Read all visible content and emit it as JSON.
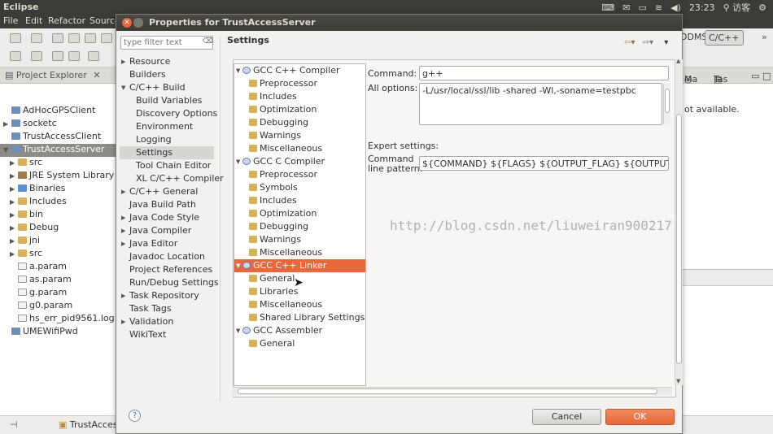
{
  "system": {
    "app_name": "Eclipse",
    "clock": "23:23",
    "user": "访客",
    "volume_icon": "volume-icon"
  },
  "menu": [
    "File",
    "Edit",
    "Refactor",
    "Source"
  ],
  "perspectives": {
    "ddms": "DDMS",
    "cc": "C/C++"
  },
  "project_explorer": {
    "tab_label": "Project Explorer",
    "items": [
      {
        "label": "AdHocGPSClient",
        "icon": "project-icon"
      },
      {
        "label": "socketc",
        "icon": "project-icon"
      },
      {
        "label": "TrustAccessClient",
        "icon": "project-icon"
      },
      {
        "label": "TrustAccessServer",
        "icon": "project-icon"
      },
      {
        "label": "src",
        "icon": "folder-icon"
      },
      {
        "label": "JRE System Library [Ja",
        "icon": "library-icon"
      },
      {
        "label": "Binaries",
        "icon": "binary-icon"
      },
      {
        "label": "Includes",
        "icon": "folder-icon"
      },
      {
        "label": "bin",
        "icon": "folder-icon"
      },
      {
        "label": "Debug",
        "icon": "folder-icon"
      },
      {
        "label": "jni",
        "icon": "folder-icon"
      },
      {
        "label": "src",
        "icon": "folder-icon"
      },
      {
        "label": "a.param",
        "icon": "file-icon"
      },
      {
        "label": "as.param",
        "icon": "file-icon"
      },
      {
        "label": "g.param",
        "icon": "file-icon"
      },
      {
        "label": "g0.param",
        "icon": "file-icon"
      },
      {
        "label": "hs_err_pid9561.log",
        "icon": "file-icon"
      },
      {
        "label": "UMEWifiPwd",
        "icon": "project-icon"
      }
    ]
  },
  "right_panel": {
    "tab_ma": "Ma",
    "tab_tas": "Tas",
    "message": "ot available."
  },
  "taskbar": {
    "item": "TrustAccessSe"
  },
  "dialog": {
    "title": "Properties for TrustAccessServer",
    "filter_placeholder": "type filter text",
    "page_title": "Settings",
    "nav": [
      {
        "label": "Resource",
        "expandable": true
      },
      {
        "label": "Builders",
        "expandable": false
      },
      {
        "label": "C/C++ Build",
        "expandable": true
      },
      {
        "label": "Build Variables",
        "expandable": false
      },
      {
        "label": "Discovery Options",
        "expandable": false
      },
      {
        "label": "Environment",
        "expandable": false
      },
      {
        "label": "Logging",
        "expandable": false
      },
      {
        "label": "Settings",
        "expandable": false
      },
      {
        "label": "Tool Chain Editor",
        "expandable": false
      },
      {
        "label": "XL C/C++ Compiler",
        "expandable": false
      },
      {
        "label": "C/C++ General",
        "expandable": true
      },
      {
        "label": "Java Build Path",
        "expandable": false
      },
      {
        "label": "Java Code Style",
        "expandable": true
      },
      {
        "label": "Java Compiler",
        "expandable": true
      },
      {
        "label": "Java Editor",
        "expandable": true
      },
      {
        "label": "Javadoc Location",
        "expandable": false
      },
      {
        "label": "Project References",
        "expandable": false
      },
      {
        "label": "Run/Debug Settings",
        "expandable": false
      },
      {
        "label": "Task Repository",
        "expandable": true
      },
      {
        "label": "Task Tags",
        "expandable": false
      },
      {
        "label": "Validation",
        "expandable": true
      },
      {
        "label": "WikiText",
        "expandable": false
      }
    ],
    "tool_settings": [
      {
        "label": "GCC C++ Compiler",
        "type": "tool"
      },
      {
        "label": "Preprocessor",
        "type": "option"
      },
      {
        "label": "Includes",
        "type": "option"
      },
      {
        "label": "Optimization",
        "type": "option"
      },
      {
        "label": "Debugging",
        "type": "option"
      },
      {
        "label": "Warnings",
        "type": "option"
      },
      {
        "label": "Miscellaneous",
        "type": "option"
      },
      {
        "label": "GCC C Compiler",
        "type": "tool"
      },
      {
        "label": "Preprocessor",
        "type": "option"
      },
      {
        "label": "Symbols",
        "type": "option"
      },
      {
        "label": "Includes",
        "type": "option"
      },
      {
        "label": "Optimization",
        "type": "option"
      },
      {
        "label": "Debugging",
        "type": "option"
      },
      {
        "label": "Warnings",
        "type": "option"
      },
      {
        "label": "Miscellaneous",
        "type": "option"
      },
      {
        "label": "GCC C++ Linker",
        "type": "tool"
      },
      {
        "label": "General",
        "type": "option"
      },
      {
        "label": "Libraries",
        "type": "option"
      },
      {
        "label": "Miscellaneous",
        "type": "option"
      },
      {
        "label": "Shared Library Settings",
        "type": "option"
      },
      {
        "label": "GCC Assembler",
        "type": "tool"
      },
      {
        "label": "General",
        "type": "option"
      }
    ],
    "command_label": "Command:",
    "command_value": "g++",
    "all_options_label": "All options:",
    "all_options_value": "-L/usr/local/ssl/lib -shared -Wl,-soname=testpbc",
    "expert_label": "Expert settings:",
    "pattern_label_1": "Command",
    "pattern_label_2": "line pattern:",
    "pattern_value": "${COMMAND} ${FLAGS} ${OUTPUT_FLAG} ${OUTPUT_PREFIX}${O",
    "cancel_label": "Cancel",
    "ok_label": "OK",
    "watermark": "http://blog.csdn.net/liuweiran900217"
  }
}
